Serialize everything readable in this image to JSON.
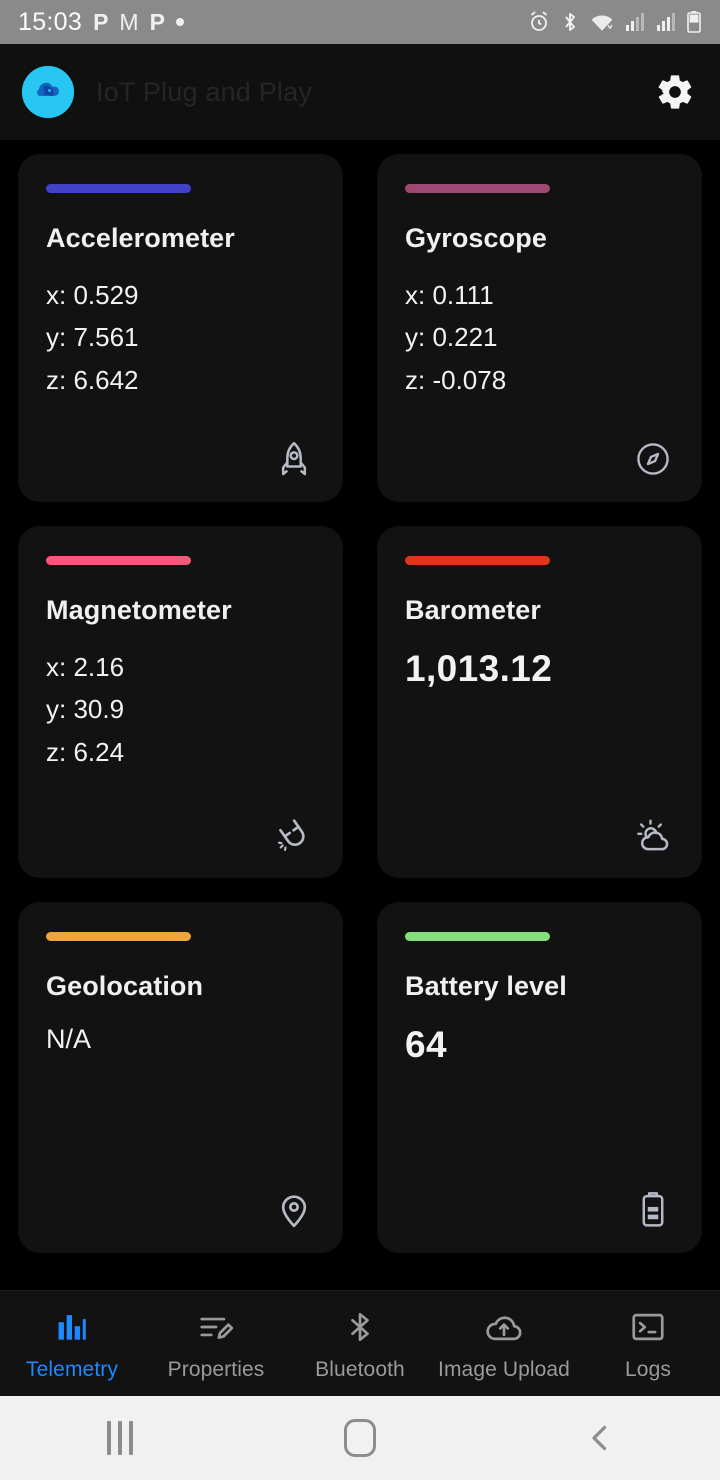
{
  "status_bar": {
    "time": "15:03",
    "left_icons": [
      "app-p-icon",
      "gmail-m-icon",
      "app-p-icon",
      "dot-icon"
    ],
    "right_icons": [
      "alarm-icon",
      "bluetooth-icon",
      "wifi-icon",
      "signal-icon",
      "signal-icon",
      "battery-icon"
    ]
  },
  "header": {
    "title": "IoT Plug and Play",
    "logo_name": "app-logo",
    "settings_label": "Settings"
  },
  "cards": [
    {
      "name": "accelerometer",
      "title": "Accelerometer",
      "accent": "#4242C8",
      "icon": "rocket-icon",
      "type": "axes",
      "axes": [
        "x: 0.529",
        "y: 7.561",
        "z: 6.642"
      ]
    },
    {
      "name": "gyroscope",
      "title": "Gyroscope",
      "accent": "#9E4873",
      "icon": "compass-icon",
      "type": "axes",
      "axes": [
        "x: 0.111",
        "y: 0.221",
        "z: -0.078"
      ]
    },
    {
      "name": "magnetometer",
      "title": "Magnetometer",
      "accent": "#F4587A",
      "icon": "magnet-icon",
      "type": "axes",
      "axes": [
        "x: 2.16",
        "y: 30.9",
        "z: 6.24"
      ]
    },
    {
      "name": "barometer",
      "title": "Barometer",
      "accent": "#E13418",
      "icon": "weather-cloud-icon",
      "type": "value",
      "value": "1,013.12"
    },
    {
      "name": "geolocation",
      "title": "Geolocation",
      "accent": "#F0A43C",
      "icon": "map-pin-icon",
      "type": "na",
      "value": "N/A"
    },
    {
      "name": "battery-level",
      "title": "Battery level",
      "accent": "#86DE7D",
      "icon": "battery-icon",
      "type": "value",
      "value": "64"
    }
  ],
  "tabs": [
    {
      "label": "Telemetry",
      "icon": "bar-chart-icon",
      "active": true
    },
    {
      "label": "Properties",
      "icon": "list-edit-icon",
      "active": false
    },
    {
      "label": "Bluetooth",
      "icon": "bluetooth-icon",
      "active": false
    },
    {
      "label": "Image Upload",
      "icon": "cloud-upload-icon",
      "active": false
    },
    {
      "label": "Logs",
      "icon": "terminal-icon",
      "active": false
    }
  ],
  "android_nav": {
    "recents_label": "Recents",
    "home_label": "Home",
    "back_label": "Back"
  },
  "colors": {
    "active_tab": "#1E88FF",
    "card_bg": "#121212",
    "page_bg": "#000000"
  }
}
